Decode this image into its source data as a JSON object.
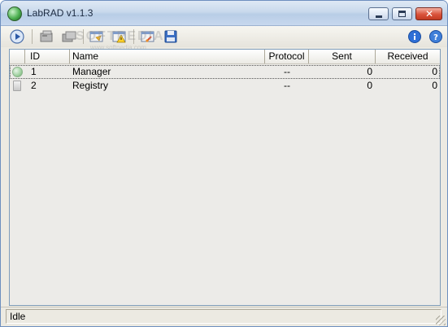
{
  "window": {
    "title": "LabRAD v1.1.3"
  },
  "watermark": {
    "main": "SOFTPEDIA",
    "sub": "www.softpedia.com"
  },
  "toolbar": {
    "icons": [
      "play-icon",
      "server-gray-icon",
      "server-stack-icon",
      "folder-open-icon",
      "warning-icon",
      "export-icon",
      "save-icon",
      "info-icon",
      "help-icon"
    ]
  },
  "table": {
    "columns": [
      "ID",
      "Name",
      "Protocol",
      "Sent",
      "Received"
    ],
    "rows": [
      {
        "id": "1",
        "name": "Manager",
        "protocol": "--",
        "sent": "0",
        "received": "0",
        "icon": "globe-icon"
      },
      {
        "id": "2",
        "name": "Registry",
        "protocol": "--",
        "sent": "0",
        "received": "0",
        "icon": "document-icon"
      }
    ]
  },
  "status": {
    "text": "Idle"
  },
  "colors": {
    "accent": "#2e6fd6",
    "titlebar": "#c9d9ec",
    "close": "#d9523b"
  }
}
